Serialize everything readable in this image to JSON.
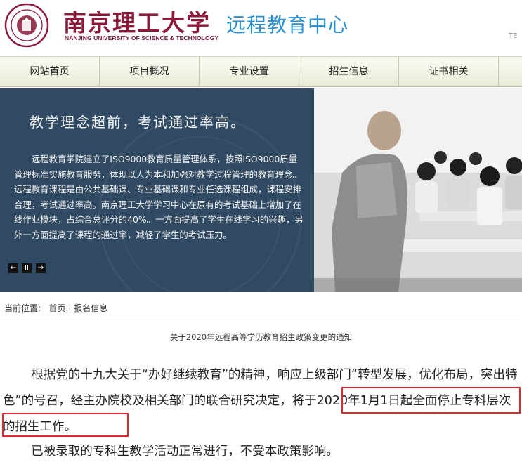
{
  "header": {
    "university_cn": "南京理工大学",
    "university_en": "NANJING UNIVERSITY OF SCIENCE & TECHNOLOGY",
    "center_title": "远程教育中心",
    "lang_link": "TE"
  },
  "nav": {
    "items": [
      {
        "label": "网站首页"
      },
      {
        "label": "项目概况"
      },
      {
        "label": "专业设置"
      },
      {
        "label": "招生信息"
      },
      {
        "label": "证书相关"
      }
    ]
  },
  "banner": {
    "slogan": "教学理念超前，考试通过率高。",
    "body": "远程教育学院建立了ISO9000教育质量管理体系，按照ISO9000质量管理标准实施教育服务，体现以人为本和加强对教学过程管理的教育理念。远程教育课程是由公共基础课、专业基础课和专业任选课程组成，课程安排合理，考试通过率高。南京理工大学学习中心在原有的考试基础上增加了在线作业模块，占综合总评分的40%。一方面提高了学生在线学习的兴趣，另外一方面提高了课程的通过率，减轻了学生的考试压力。",
    "controls": {
      "prev": "←",
      "pause": "II",
      "next": "→"
    }
  },
  "breadcrumb": {
    "prefix": "当前位置:",
    "home": "首页",
    "separator": "|",
    "current": "报名信息"
  },
  "article": {
    "title": "关于2020年远程高等学历教育招生政策变更的通知",
    "p1_before": "根据党的十九大关于“办好继续教育”的精神，响应上级部门“转型发展，优化布局，突出特色”的号召，经主办院校及相关部门的联合研究决定，",
    "p1_highlight": "将于2020年1月1日起全面停止专科层次的招生工作。",
    "p2": "已被录取的专科生教学活动正常进行，不受本政策影响。"
  },
  "colors": {
    "brand_maroon": "#8a1a3a",
    "title_blue": "#2a8fd0",
    "banner_bg": "#2f4a62",
    "highlight_red": "#e0282f"
  }
}
